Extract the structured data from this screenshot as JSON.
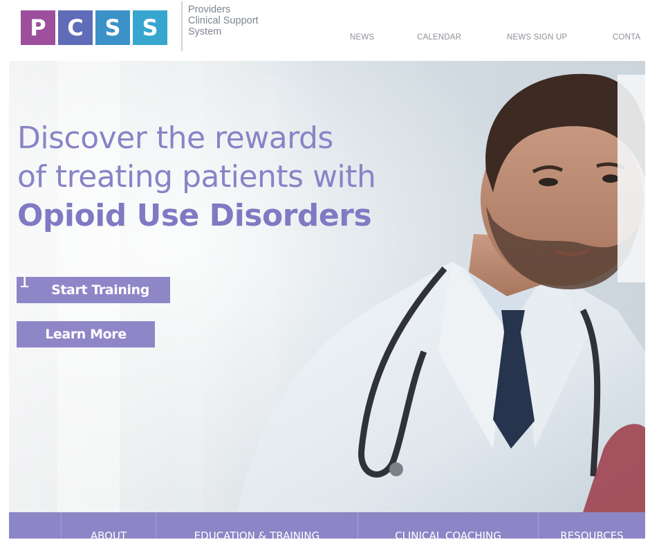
{
  "header": {
    "logo": {
      "letters": [
        "P",
        "C",
        "S",
        "S"
      ],
      "colors": [
        "#9d4f9e",
        "#5f6cb8",
        "#3c92c7",
        "#36a6cf"
      ],
      "name_lines": [
        "Providers",
        "Clinical Support",
        "System"
      ]
    },
    "nav": [
      "NEWS",
      "CALENDAR",
      "NEWS SIGN UP",
      "CONTA"
    ]
  },
  "hero": {
    "headline": [
      "Discover the rewards",
      "of treating patients with",
      "Opioid Use Disorders"
    ],
    "marker": "1",
    "buttons": {
      "start_training": "Start Training",
      "learn_more": "Learn More"
    }
  },
  "bottom_nav": [
    "ABOUT",
    "EDUCATION & TRAINING",
    "CLINICAL COACHING",
    "RESOURCES"
  ],
  "colors": {
    "accent": "#8c85c6",
    "headline": "#8983c6"
  }
}
